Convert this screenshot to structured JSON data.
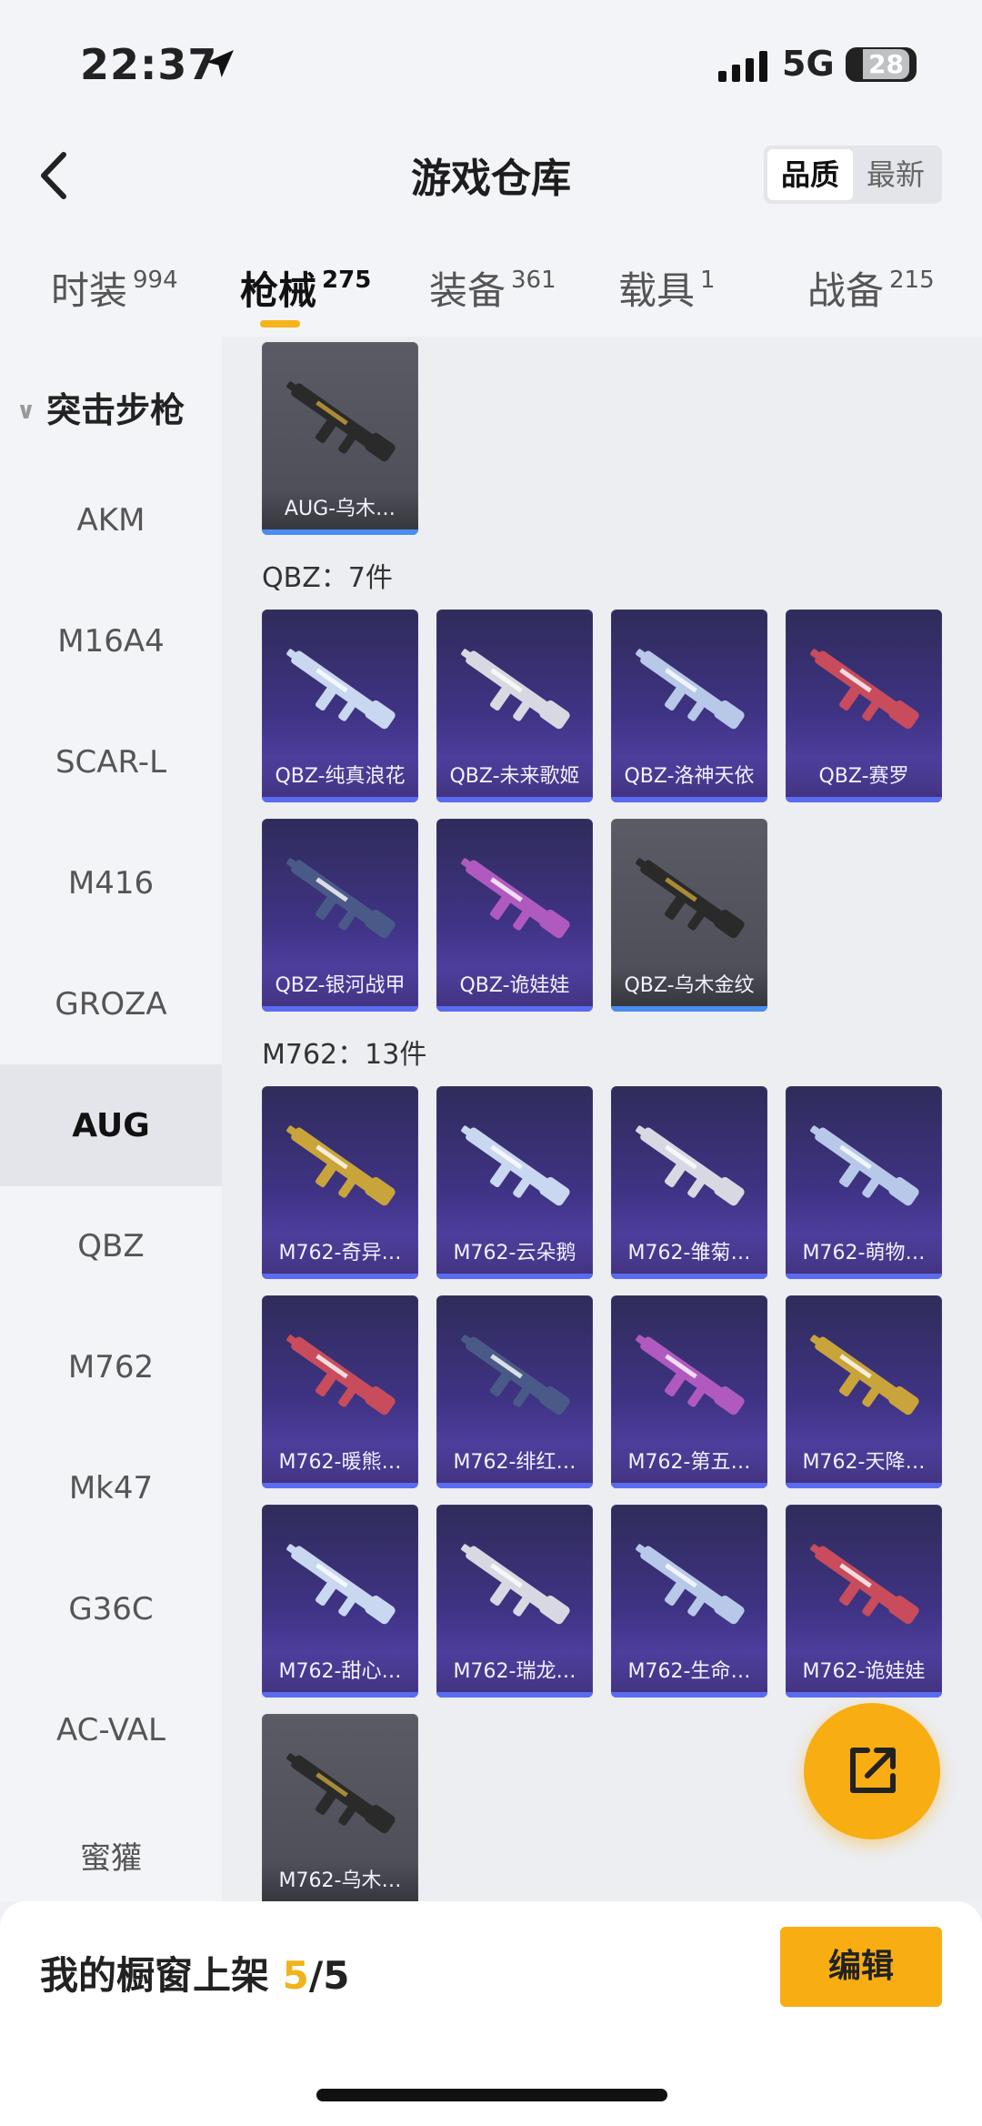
{
  "status": {
    "time": "22:37",
    "network": "5G",
    "battery": "28"
  },
  "header": {
    "title": "游戏仓库",
    "sort_options": [
      "品质",
      "最新"
    ],
    "sort_selected": "品质"
  },
  "tabs": [
    {
      "label": "时装",
      "count": "994"
    },
    {
      "label": "枪械",
      "count": "275"
    },
    {
      "label": "装备",
      "count": "361"
    },
    {
      "label": "载具",
      "count": "1"
    },
    {
      "label": "战备",
      "count": "215"
    }
  ],
  "active_tab": "枪械",
  "sidebar": {
    "category": "突击步枪",
    "items": [
      "AKM",
      "M16A4",
      "SCAR-L",
      "M416",
      "GROZA",
      "AUG",
      "QBZ",
      "M762",
      "Mk47",
      "G36C",
      "AC-VAL",
      "蜜獾"
    ],
    "active": "AUG"
  },
  "sections": [
    {
      "title": "",
      "items": [
        {
          "name": "AUG-乌木…",
          "rarity": "gray"
        }
      ]
    },
    {
      "title": "QBZ：7件",
      "items": [
        {
          "name": "QBZ-纯真浪花",
          "rarity": "purple"
        },
        {
          "name": "QBZ-未来歌姬",
          "rarity": "purple"
        },
        {
          "name": "QBZ-洛神天依",
          "rarity": "purple"
        },
        {
          "name": "QBZ-赛罗",
          "rarity": "purple"
        },
        {
          "name": "QBZ-银河战甲",
          "rarity": "purple"
        },
        {
          "name": "QBZ-诡娃娃",
          "rarity": "purple"
        },
        {
          "name": "QBZ-乌木金纹",
          "rarity": "gray"
        }
      ]
    },
    {
      "title": "M762：13件",
      "items": [
        {
          "name": "M762-奇异…",
          "rarity": "purple"
        },
        {
          "name": "M762-云朵鹅",
          "rarity": "purple"
        },
        {
          "name": "M762-雏菊…",
          "rarity": "purple"
        },
        {
          "name": "M762-萌物…",
          "rarity": "purple"
        },
        {
          "name": "M762-暖熊…",
          "rarity": "purple"
        },
        {
          "name": "M762-绯红…",
          "rarity": "purple"
        },
        {
          "name": "M762-第五…",
          "rarity": "purple"
        },
        {
          "name": "M762-天降…",
          "rarity": "purple"
        },
        {
          "name": "M762-甜心…",
          "rarity": "purple"
        },
        {
          "name": "M762-瑞龙…",
          "rarity": "purple"
        },
        {
          "name": "M762-生命…",
          "rarity": "purple"
        },
        {
          "name": "M762-诡娃娃",
          "rarity": "purple"
        },
        {
          "name": "M762-乌木…",
          "rarity": "gray"
        }
      ]
    }
  ],
  "footer": {
    "label": "我的橱窗上架",
    "shown": "5",
    "total": "/5",
    "edit_label": "编辑"
  },
  "colors": {
    "accent": "#f8ad13",
    "purple_card": "#3f3385",
    "gray_card": "#55565f"
  }
}
